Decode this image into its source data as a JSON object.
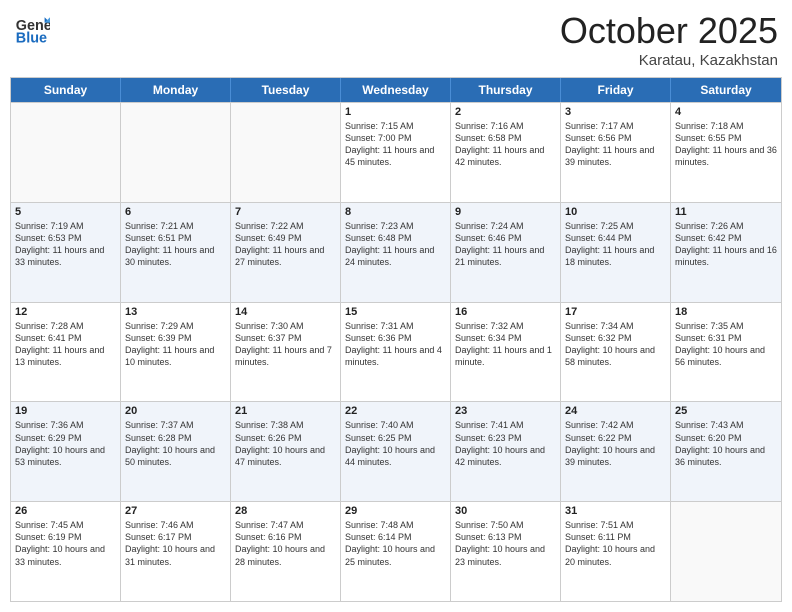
{
  "header": {
    "logo_general": "General",
    "logo_blue": "Blue",
    "month_title": "October 2025",
    "location": "Karatau, Kazakhstan"
  },
  "weekdays": [
    "Sunday",
    "Monday",
    "Tuesday",
    "Wednesday",
    "Thursday",
    "Friday",
    "Saturday"
  ],
  "rows": [
    [
      {
        "day": "",
        "info": ""
      },
      {
        "day": "",
        "info": ""
      },
      {
        "day": "",
        "info": ""
      },
      {
        "day": "1",
        "info": "Sunrise: 7:15 AM\nSunset: 7:00 PM\nDaylight: 11 hours and 45 minutes."
      },
      {
        "day": "2",
        "info": "Sunrise: 7:16 AM\nSunset: 6:58 PM\nDaylight: 11 hours and 42 minutes."
      },
      {
        "day": "3",
        "info": "Sunrise: 7:17 AM\nSunset: 6:56 PM\nDaylight: 11 hours and 39 minutes."
      },
      {
        "day": "4",
        "info": "Sunrise: 7:18 AM\nSunset: 6:55 PM\nDaylight: 11 hours and 36 minutes."
      }
    ],
    [
      {
        "day": "5",
        "info": "Sunrise: 7:19 AM\nSunset: 6:53 PM\nDaylight: 11 hours and 33 minutes."
      },
      {
        "day": "6",
        "info": "Sunrise: 7:21 AM\nSunset: 6:51 PM\nDaylight: 11 hours and 30 minutes."
      },
      {
        "day": "7",
        "info": "Sunrise: 7:22 AM\nSunset: 6:49 PM\nDaylight: 11 hours and 27 minutes."
      },
      {
        "day": "8",
        "info": "Sunrise: 7:23 AM\nSunset: 6:48 PM\nDaylight: 11 hours and 24 minutes."
      },
      {
        "day": "9",
        "info": "Sunrise: 7:24 AM\nSunset: 6:46 PM\nDaylight: 11 hours and 21 minutes."
      },
      {
        "day": "10",
        "info": "Sunrise: 7:25 AM\nSunset: 6:44 PM\nDaylight: 11 hours and 18 minutes."
      },
      {
        "day": "11",
        "info": "Sunrise: 7:26 AM\nSunset: 6:42 PM\nDaylight: 11 hours and 16 minutes."
      }
    ],
    [
      {
        "day": "12",
        "info": "Sunrise: 7:28 AM\nSunset: 6:41 PM\nDaylight: 11 hours and 13 minutes."
      },
      {
        "day": "13",
        "info": "Sunrise: 7:29 AM\nSunset: 6:39 PM\nDaylight: 11 hours and 10 minutes."
      },
      {
        "day": "14",
        "info": "Sunrise: 7:30 AM\nSunset: 6:37 PM\nDaylight: 11 hours and 7 minutes."
      },
      {
        "day": "15",
        "info": "Sunrise: 7:31 AM\nSunset: 6:36 PM\nDaylight: 11 hours and 4 minutes."
      },
      {
        "day": "16",
        "info": "Sunrise: 7:32 AM\nSunset: 6:34 PM\nDaylight: 11 hours and 1 minute."
      },
      {
        "day": "17",
        "info": "Sunrise: 7:34 AM\nSunset: 6:32 PM\nDaylight: 10 hours and 58 minutes."
      },
      {
        "day": "18",
        "info": "Sunrise: 7:35 AM\nSunset: 6:31 PM\nDaylight: 10 hours and 56 minutes."
      }
    ],
    [
      {
        "day": "19",
        "info": "Sunrise: 7:36 AM\nSunset: 6:29 PM\nDaylight: 10 hours and 53 minutes."
      },
      {
        "day": "20",
        "info": "Sunrise: 7:37 AM\nSunset: 6:28 PM\nDaylight: 10 hours and 50 minutes."
      },
      {
        "day": "21",
        "info": "Sunrise: 7:38 AM\nSunset: 6:26 PM\nDaylight: 10 hours and 47 minutes."
      },
      {
        "day": "22",
        "info": "Sunrise: 7:40 AM\nSunset: 6:25 PM\nDaylight: 10 hours and 44 minutes."
      },
      {
        "day": "23",
        "info": "Sunrise: 7:41 AM\nSunset: 6:23 PM\nDaylight: 10 hours and 42 minutes."
      },
      {
        "day": "24",
        "info": "Sunrise: 7:42 AM\nSunset: 6:22 PM\nDaylight: 10 hours and 39 minutes."
      },
      {
        "day": "25",
        "info": "Sunrise: 7:43 AM\nSunset: 6:20 PM\nDaylight: 10 hours and 36 minutes."
      }
    ],
    [
      {
        "day": "26",
        "info": "Sunrise: 7:45 AM\nSunset: 6:19 PM\nDaylight: 10 hours and 33 minutes."
      },
      {
        "day": "27",
        "info": "Sunrise: 7:46 AM\nSunset: 6:17 PM\nDaylight: 10 hours and 31 minutes."
      },
      {
        "day": "28",
        "info": "Sunrise: 7:47 AM\nSunset: 6:16 PM\nDaylight: 10 hours and 28 minutes."
      },
      {
        "day": "29",
        "info": "Sunrise: 7:48 AM\nSunset: 6:14 PM\nDaylight: 10 hours and 25 minutes."
      },
      {
        "day": "30",
        "info": "Sunrise: 7:50 AM\nSunset: 6:13 PM\nDaylight: 10 hours and 23 minutes."
      },
      {
        "day": "31",
        "info": "Sunrise: 7:51 AM\nSunset: 6:11 PM\nDaylight: 10 hours and 20 minutes."
      },
      {
        "day": "",
        "info": ""
      }
    ]
  ]
}
